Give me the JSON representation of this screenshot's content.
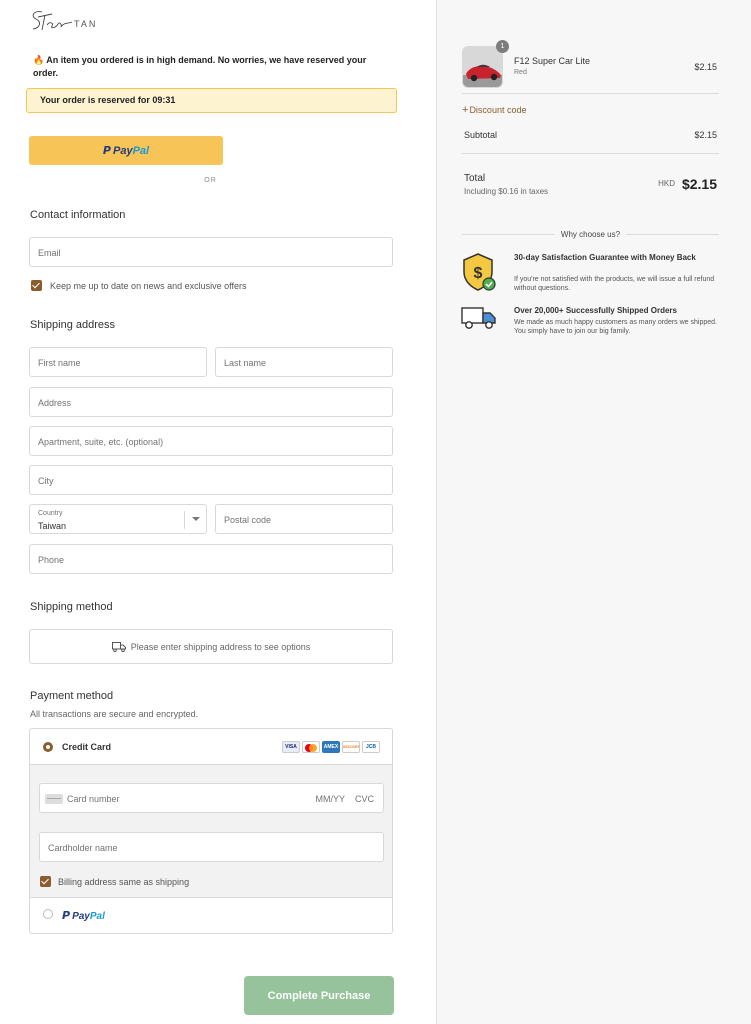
{
  "store": {
    "brand": "TAN",
    "signature": "Steve"
  },
  "alert": {
    "demand": "An item you ordered is in high demand. No worries, we have reserved your order.",
    "reserved": "Your order is reserved for 09:31"
  },
  "express": {
    "paypal_pay": "Pay",
    "paypal_pal": "Pal",
    "or": "OR"
  },
  "contact": {
    "title": "Contact information",
    "email_placeholder": "Email",
    "newsletter_label": "Keep me up to date on news and exclusive offers"
  },
  "shipping": {
    "title": "Shipping address",
    "first_name": "First name",
    "last_name": "Last name",
    "address": "Address",
    "apartment": "Apartment, suite, etc. (optional)",
    "city": "City",
    "country_label": "Country",
    "country_value": "Taiwan",
    "postal": "Postal code",
    "phone": "Phone"
  },
  "shipping_method": {
    "title": "Shipping method",
    "note": "Please enter shipping address to see options"
  },
  "payment": {
    "title": "Payment method",
    "note": "All transactions are secure and encrypted.",
    "credit_card_label": "Credit Card",
    "cards": [
      "VISA",
      "Mastercard",
      "AMEX",
      "DISCOVER",
      "JCB"
    ],
    "card_number": "Card number",
    "expiry": "MM/YY",
    "cvc": "CVC",
    "cardholder": "Cardholder name",
    "billing_same": "Billing address same as shipping",
    "paypal_pay": "Pay",
    "paypal_pal": "Pal"
  },
  "complete_button": "Complete Purchase",
  "summary": {
    "quantity": "1",
    "product_name": "F12 Super Car Lite",
    "variant": "Red",
    "product_price": "$2.15",
    "discount": "Discount code",
    "subtotal_label": "Subtotal",
    "subtotal_value": "$2.15",
    "total_label": "Total",
    "tax_note": "Including $0.16 in taxes",
    "currency": "HKD",
    "total_value": "$2.15"
  },
  "why": {
    "title": "Why choose us?",
    "features": [
      {
        "icon": "money-shield-icon",
        "title": "30-day Satisfaction Guarantee with Money Back",
        "desc": "If you're not satisfied with the products, we will issue a full refund without questions."
      },
      {
        "icon": "truck-icon",
        "title": "Over 20,000+ Successfully Shipped Orders",
        "desc": "We made as much happy customers as many orders we shipped. You simply have to join our big family."
      }
    ]
  },
  "colors": {
    "accent": "#8b5d2e",
    "paypal_button": "#f7c557",
    "complete_button": "#96c39b",
    "reserved_bg": "#fdf3d1"
  }
}
